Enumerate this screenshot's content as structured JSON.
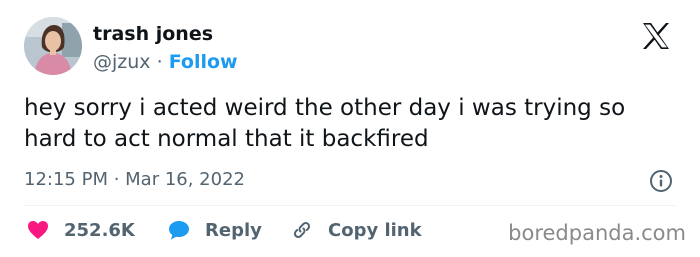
{
  "author": {
    "name": "trash jones",
    "handle": "@jzux",
    "separator": "·",
    "follow_label": "Follow"
  },
  "tweet": {
    "text": "hey sorry i acted weird the other day i was trying so hard to act normal that it backfired",
    "timestamp": "12:15 PM · Mar 16, 2022"
  },
  "actions": {
    "likes": "252.6K",
    "reply_label": "Reply",
    "copy_link_label": "Copy link"
  },
  "watermark": "boredpanda.com",
  "colors": {
    "text": "#0f1419",
    "secondary": "#536471",
    "link": "#1d9bf0",
    "like": "#f91880",
    "reply": "#1d9bf0",
    "divider": "#eff3f4"
  },
  "icons": {
    "brand": "x-logo-icon",
    "info": "info-icon",
    "like": "heart-icon",
    "reply": "reply-bubble-icon",
    "copy": "link-icon"
  }
}
